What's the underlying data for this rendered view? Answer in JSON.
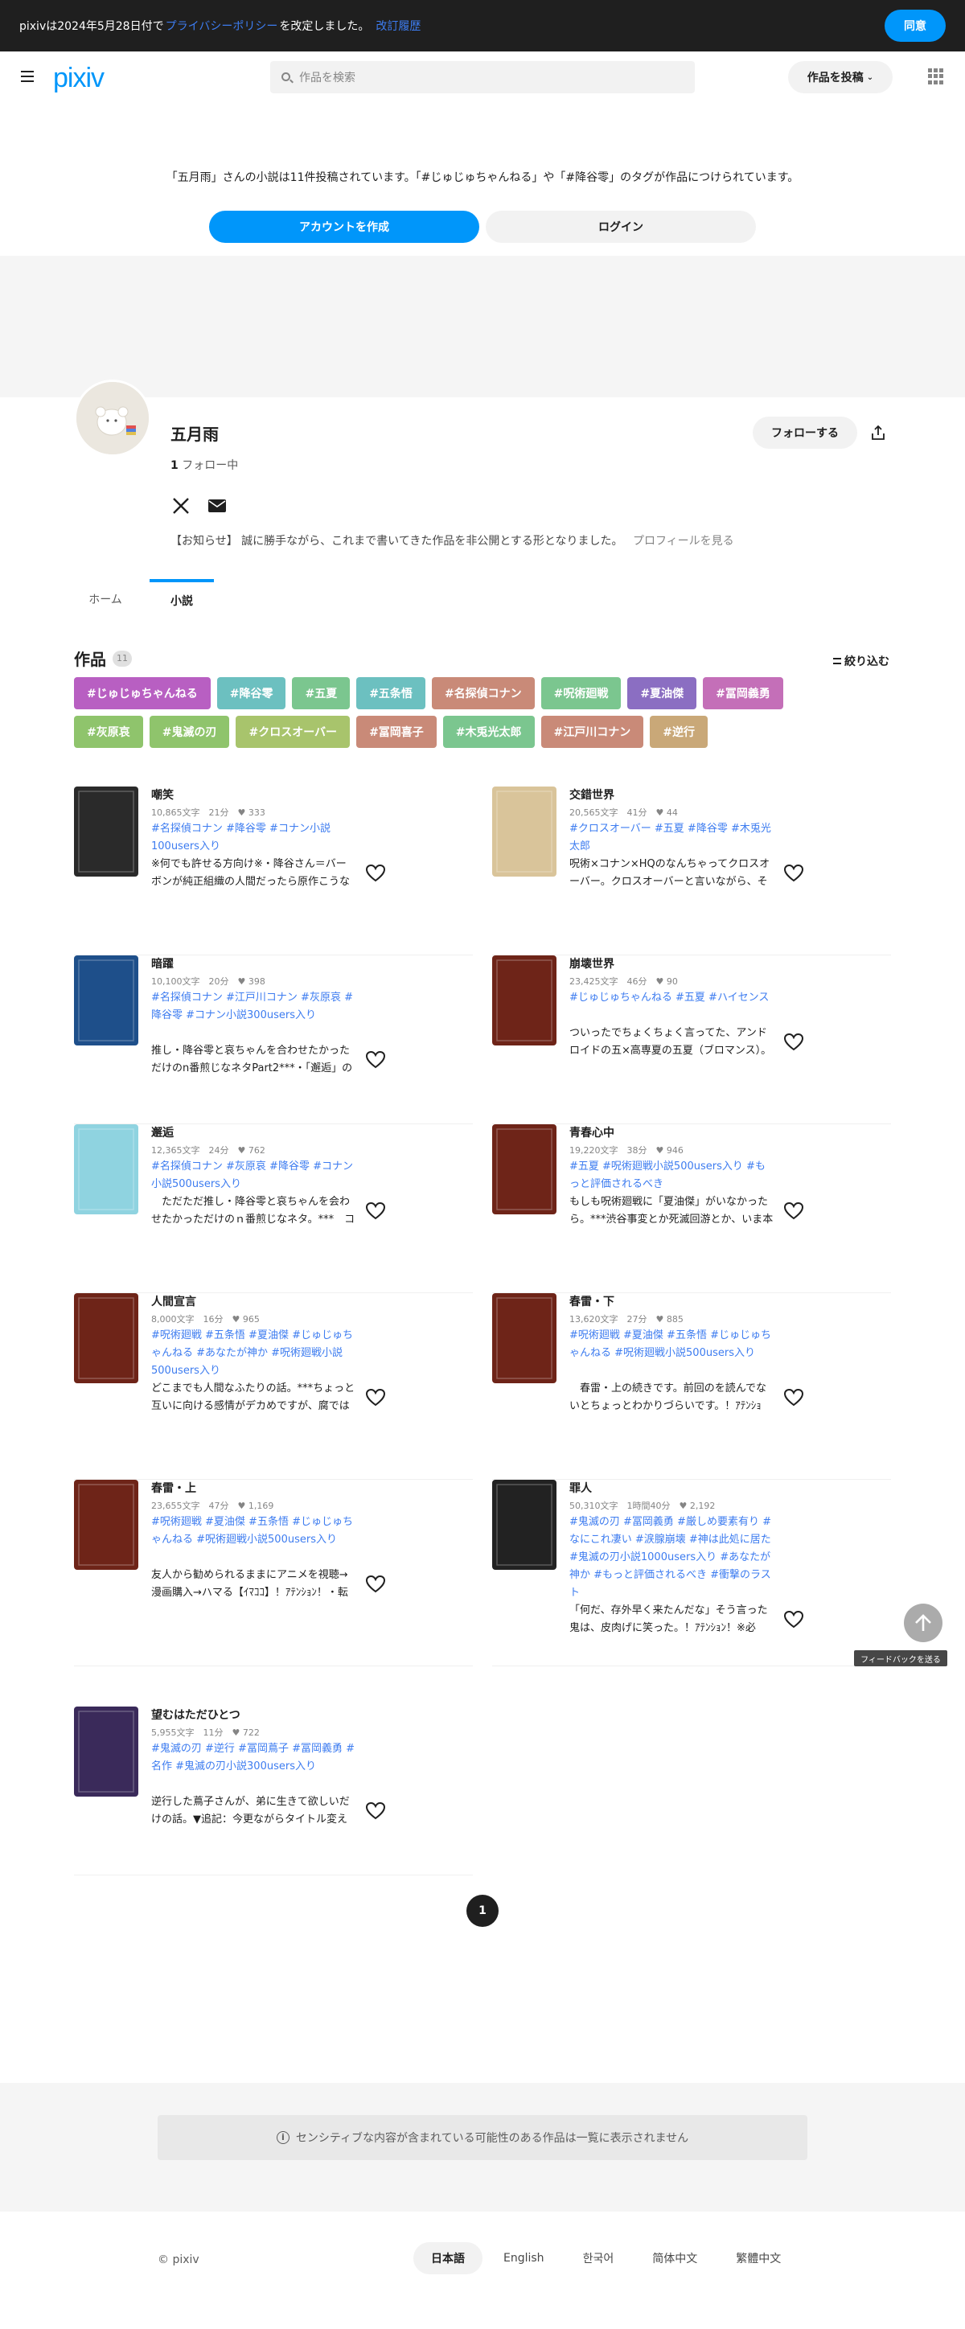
{
  "notice": {
    "before": "pixivは2024年5月28日付で",
    "link": "プライバシーポリシー",
    "after": "を改定しました。",
    "history": "改訂履歴",
    "agree": "同意"
  },
  "header": {
    "logo": "pixiv",
    "search_placeholder": "作品を検索",
    "post_button": "作品を投稿"
  },
  "intro": {
    "text": "「五月雨」さんの小説は11件投稿されています。「#じゅじゅちゃんねる」や「#降谷零」のタグが作品につけられています。",
    "create_account": "アカウントを作成",
    "login": "ログイン"
  },
  "profile": {
    "name": "五月雨",
    "follow_count": "1",
    "follow_label": "フォロー中",
    "follow_button": "フォローする",
    "bio": "【お知らせ】 誠に勝手ながら、これまで書いてきた作品を非公開とする形となりました。",
    "bio_more": "プロフィールを見る"
  },
  "tabs": {
    "home": "ホーム",
    "novel": "小説"
  },
  "works": {
    "title": "作品",
    "count": "11",
    "filter": "絞り込む",
    "tag_rows": [
      [
        {
          "label": "#じゅじゅちゃんねる",
          "color": "#b85fc2"
        },
        {
          "label": "#降谷零",
          "color": "#6cc0c0"
        },
        {
          "label": "#五夏",
          "color": "#7bc68f"
        },
        {
          "label": "#五条悟",
          "color": "#6cc0c0"
        },
        {
          "label": "#名探偵コナン",
          "color": "#c98a78"
        },
        {
          "label": "#呪術廻戦",
          "color": "#7bc68f"
        },
        {
          "label": "#夏油傑",
          "color": "#8b6ec2"
        },
        {
          "label": "#冨岡義勇",
          "color": "#c46fb8"
        }
      ],
      [
        {
          "label": "#灰原哀",
          "color": "#8fc46c"
        },
        {
          "label": "#鬼滅の刃",
          "color": "#8fc46c"
        },
        {
          "label": "#クロスオーバー",
          "color": "#a8c46c"
        },
        {
          "label": "#冨岡喜子",
          "color": "#c98a78"
        },
        {
          "label": "#木兎光太郎",
          "color": "#7bc68f"
        },
        {
          "label": "#江戸川コナン",
          "color": "#c98a78"
        },
        {
          "label": "#逆行",
          "color": "#c9a878"
        }
      ]
    ],
    "cards": [
      {
        "title": "嘲笑",
        "meta": "10,865文字　21分　♥ 333",
        "tags": "#名探偵コナン #降谷零 #コナン小説100users入り",
        "desc": "※何でも許せる方向け※・降谷さん＝バーボンが純正組織の人間だったら原作こうなってもおかしくないんじゃね、な…",
        "thumb": "#2a2a2a"
      },
      {
        "title": "交錯世界",
        "meta": "20,565文字　41分　♥ 44",
        "tags": "#クロスオーバー #五夏 #降谷零 #木兎光太郎",
        "desc": "呪術×コナン×HQのなんちゃってクロスオーバー。クロスオーバーと言いながら、それぞれの推しくらいしか出ませ…",
        "thumb": "#d9c49a"
      },
      {
        "title": "暗躍",
        "meta": "10,100文字　20分　♥ 398",
        "tags": "#名探偵コナン #江戸川コナン #灰原哀 #降谷零 #コナン小説300users入り",
        "desc": "推し・降谷零と哀ちゃんを合わせたかっただけのn番煎じなネタPart2***・「邂逅」の続き。前作読んでないとたぶん…",
        "thumb": "#1e4f8a"
      },
      {
        "title": "崩壊世界",
        "meta": "23,425文字　46分　♥ 90",
        "tags": "#じゅじゅちゃんねる #五夏 #ハイセンス",
        "desc": "ついったでちょくちょく言ってた、アンドロイドの五×高専夏の五夏（ブロマンス）。プロットというか、大まかな粋…",
        "thumb": "#6e2418"
      },
      {
        "title": "邂逅",
        "meta": "12,365文字　24分　♥ 762",
        "tags": "#名探偵コナン #灰原哀 #降谷零 #コナン小説500users入り",
        "desc": "　ただただ推し・降谷零と哀ちゃんを会わせたかっただけのｎ番煎じなネタ。***　コナンは純黒を期に降谷さんとい…",
        "thumb": "#8fd3e0"
      },
      {
        "title": "青春心中",
        "meta": "19,220文字　38分　♥ 946",
        "tags": "#五夏 #呪術廻戦小説500users入り #もっと評価されるべき",
        "desc": "もしも呪術廻戦に「夏油傑」がいなかったら。***渋谷事変とか死滅回游とか、いま本誌で起きてる様々な事柄は、個…",
        "thumb": "#6e2418"
      },
      {
        "title": "人間宣言",
        "meta": "8,000文字　16分　♥ 965",
        "tags": "#呪術廻戦 #五条悟 #夏油傑 #じゅじゅちゃんねる #あなたが神か #呪術廻戦小説500users入り",
        "desc": "どこまでも人間なふたりの話。***ちょっと互いに向ける感情がデカめですが、腐ではないです。呪術は五条先生と夏…",
        "thumb": "#6e2418"
      },
      {
        "title": "春雷・下",
        "meta": "13,620文字　27分　♥ 885",
        "tags": "#呪術廻戦 #夏油傑 #五条悟 #じゅじゅちゃんねる #呪術廻戦小説500users入り",
        "desc": "　春雷・上の続きです。前回のを読んでないとちょっとわかりづらいです。！ｱﾃﾝｼｮﾝ！・転生パロ。・原作ほどの呪霊…",
        "thumb": "#6e2418"
      },
      {
        "title": "春雷・上",
        "meta": "23,655文字　47分　♥ 1,169",
        "tags": "#呪術廻戦 #夏油傑 #五条悟 #じゅじゅちゃんねる #呪術廻戦小説500users入り",
        "desc": "友人から勧められるままにアニメを視聴→漫画購入→ハマる【ｲﾏｺｺ】！ｱﾃﾝｼｮﾝ！・転生パロ。・原作ほどの呪霊は…",
        "thumb": "#6e2418"
      },
      {
        "title": "罪人",
        "meta": "50,310文字　1時間40分　♥ 2,192",
        "tags": "#鬼滅の刃 #冨岡義勇 #厳しめ要素有り #なにこれ凄い #涙腺崩壊 #神は此処に居た #鬼滅の刃小説1000users入り #あなたが神か #もっと評価されるべき #衝撃のラスト",
        "desc": "「何だ、存外早く来たんだな」そう言った鬼は、皮肉げに笑った。！ｱﾃﾝｼｮﾝ！※必読・最後のほう、無惨様へ取った作…",
        "thumb": "#222222"
      },
      {
        "title": "望むはただひとつ",
        "meta": "5,955文字　11分　♥ 722",
        "tags": "#鬼滅の刃 #逆行 #冨岡蔦子 #冨岡義勇 #名作 #鬼滅の刃小説300users入り",
        "desc": "逆行した蔦子さんが、弟に生きて欲しいだけの話。▼追記：今更ながらタイトル変えました（11/8）！ｱﾃﾝｼｮﾝ！蔦子さ…",
        "thumb": "#3a2a5a"
      }
    ]
  },
  "pagination": {
    "current": "1"
  },
  "feedback": "フィードバックを送る",
  "sensitive_notice": "センシティブな内容が含まれている可能性のある作品は一覧に表示されません",
  "footer": {
    "copyright": "© pixiv",
    "languages": [
      "日本語",
      "English",
      "한국어",
      "简体中文",
      "繁體中文"
    ]
  }
}
